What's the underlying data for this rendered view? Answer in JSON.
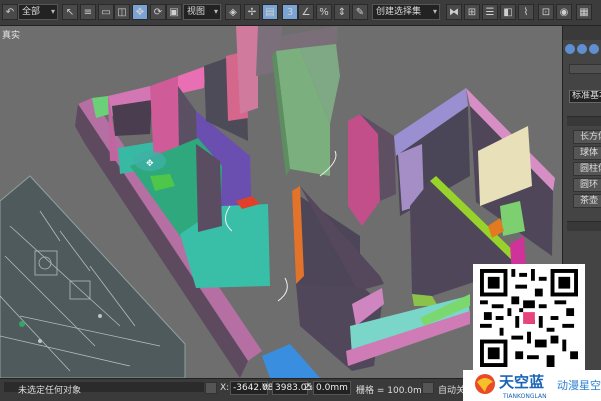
{
  "toolbar": {
    "selection_filter": "全部",
    "ref_coord": "视图",
    "named_selection": "创建选择集",
    "snap_label": "3"
  },
  "viewport": {
    "label": "真实"
  },
  "command_panel": {
    "object_type_dropdown": "标准基本体",
    "buttons": [
      "长方体",
      "球体",
      "圆柱体",
      "圆环",
      "茶壶"
    ]
  },
  "status_bar": {
    "message": "未选定任何对象",
    "x_label": "X:",
    "x_value": "-3642.089",
    "y_label": "Y:",
    "y_value": "3983.054",
    "z_label": "Z:",
    "z_value": "0.0mm",
    "grid": "栅格 = 100.0mm",
    "auto_key": "自动关"
  },
  "watermark": {
    "brand_cn": "天空蓝",
    "brand_en": "TIANKONGLAN",
    "slogan": "动漫星空"
  },
  "colors": {
    "viewport_bg": "#6e6e6e",
    "toolbar_bg": "#3c3c3c",
    "accent": "#7aa3d6",
    "brand_blue": "#1a63b5"
  }
}
